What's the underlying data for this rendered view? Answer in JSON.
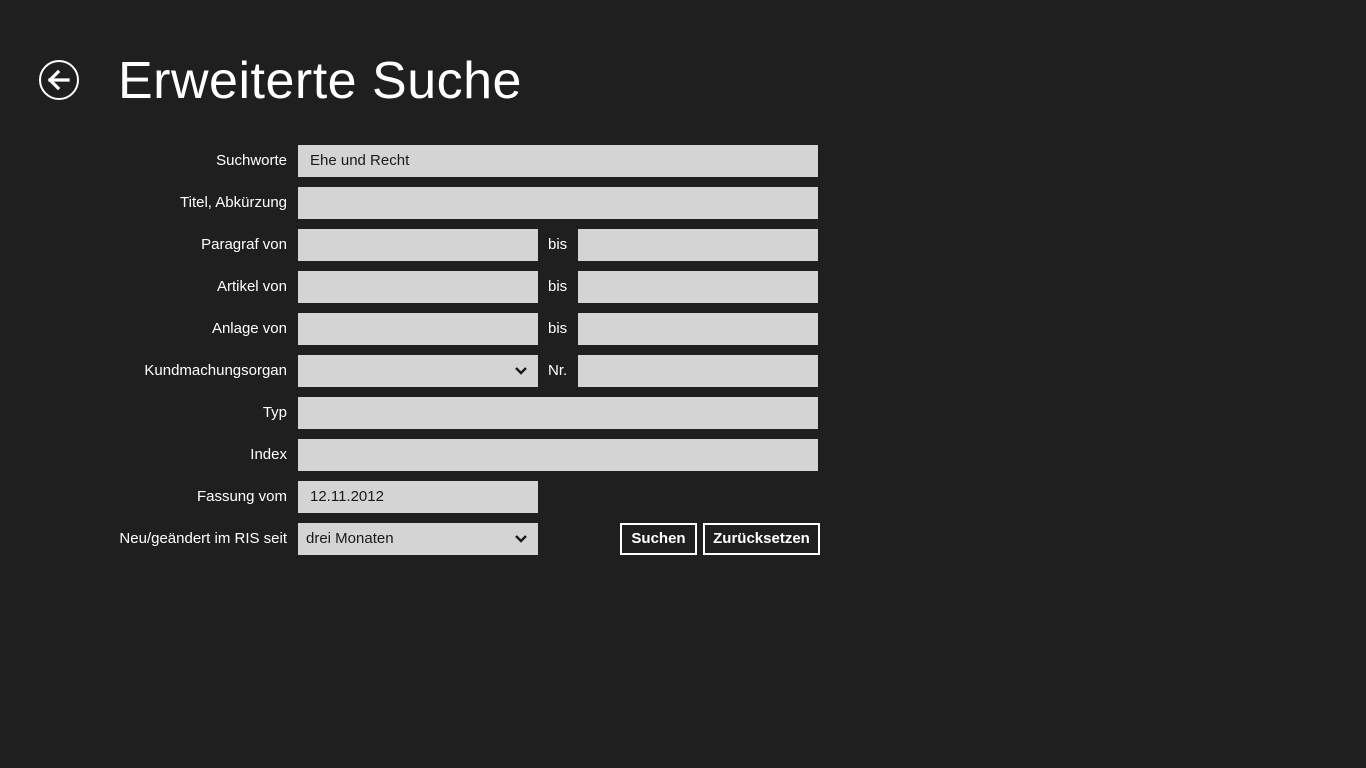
{
  "header": {
    "title": "Erweiterte Suche",
    "back_icon": "back-arrow-circle-icon"
  },
  "form": {
    "suchworte": {
      "label": "Suchworte",
      "value": "Ehe und Recht"
    },
    "titel": {
      "label": "Titel, Abkürzung",
      "value": ""
    },
    "paragraf": {
      "label": "Paragraf von",
      "bis_label": "bis",
      "from_value": "",
      "to_value": ""
    },
    "artikel": {
      "label": "Artikel von",
      "bis_label": "bis",
      "from_value": "",
      "to_value": ""
    },
    "anlage": {
      "label": "Anlage von",
      "bis_label": "bis",
      "from_value": "",
      "to_value": ""
    },
    "kundmachungsorgan": {
      "label": "Kundmachungsorgan",
      "selected": "",
      "nr_label": "Nr.",
      "nr_value": ""
    },
    "typ": {
      "label": "Typ",
      "value": ""
    },
    "index": {
      "label": "Index",
      "value": ""
    },
    "fassung": {
      "label": "Fassung vom",
      "value": "12.11.2012"
    },
    "neu_geaendert": {
      "label": "Neu/geändert im RIS seit",
      "selected": "drei Monaten"
    }
  },
  "actions": {
    "search_label": "Suchen",
    "reset_label": "Zurücksetzen"
  },
  "colors": {
    "background": "#1f1f1f",
    "field": "#d4d4d4",
    "text": "#ffffff"
  }
}
